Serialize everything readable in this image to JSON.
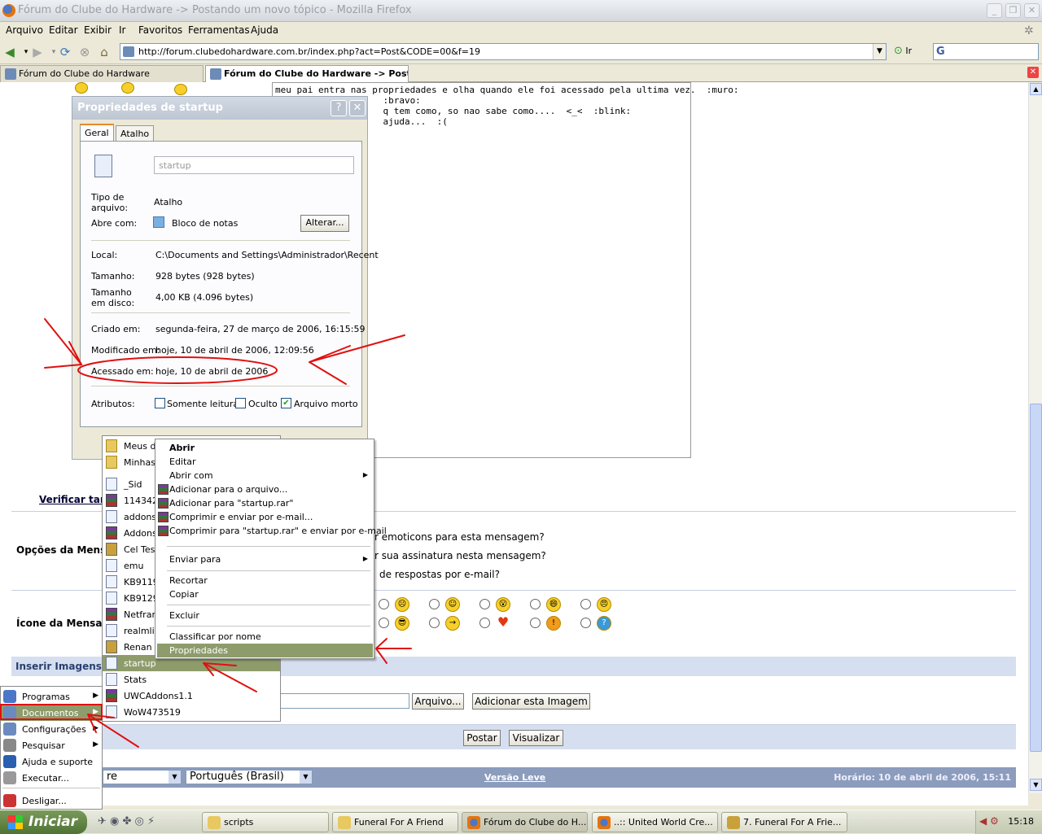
{
  "window": {
    "title": "Fórum do Clube do Hardware -> Postando um novo tópico - Mozilla Firefox"
  },
  "menubar": [
    "Arquivo",
    "Editar",
    "Exibir",
    "Ir",
    "Favoritos",
    "Ferramentas",
    "Ajuda"
  ],
  "navbar": {
    "url": "http://forum.clubedohardware.com.br/index.php?act=Post&CODE=00&f=19",
    "go_label": "Ir"
  },
  "tabs": [
    {
      "label": "Fórum do Clube do Hardware",
      "active": false
    },
    {
      "label": "Fórum do Clube do Hardware -> Post...",
      "active": true
    }
  ],
  "post": {
    "lines": [
      "meu pai entra nas propriedades e olha quando ele foi acessado pela ultima vez.  :muro:",
      "                    :bravo:",
      "                    q tem como, so nao sabe como....  <_<  :blink:",
      "                    ajuda...  :("
    ]
  },
  "form": {
    "verificar": "Verificar tar",
    "opcoes_label": "Opções da Mens",
    "opt1": "r emoticons para esta mensagem?",
    "opt2": "r sua assinatura nesta mensagem?",
    "opt3": "de respostas por e-mail?",
    "icone_label": "Ícone da Mensa",
    "inserir_label": "Inserir Imagens",
    "arquivo_button": "Arquivo...",
    "adicionar_button": "Adicionar esta Imagem",
    "postar_button": "Postar",
    "visualizar_button": "Visualizar"
  },
  "footer": {
    "skin_select": "re",
    "language_select": "Português (Brasil)",
    "versao_leve": "Versão Leve",
    "horario": "Horário: 10 de abril de 2006, 15:11"
  },
  "dialog": {
    "title": "Propriedades de startup",
    "tab_geral": "Geral",
    "tab_atalho": "Atalho",
    "name_value": "startup",
    "tipo_label": "Tipo de arquivo:",
    "tipo_value": "Atalho",
    "abre_label": "Abre com:",
    "abre_value": "Bloco de notas",
    "alterar_button": "Alterar...",
    "local_label": "Local:",
    "local_value": "C:\\Documents and Settings\\Administrador\\Recent",
    "tamanho_label": "Tamanho:",
    "tamanho_value": "928 bytes (928 bytes)",
    "tamanho_disco_label": "Tamanho em disco:",
    "tamanho_disco_value": "4,00 KB (4.096 bytes)",
    "criado_label": "Criado em:",
    "criado_value": "segunda-feira, 27 de março de 2006, 16:15:59",
    "modificado_label": "Modificado em:",
    "modificado_value": "hoje, 10 de abril de 2006, 12:09:56",
    "acessado_label": "Acessado em:",
    "acessado_value": "hoje, 10 de abril de 2006",
    "atributos_label": "Atributos:",
    "somente_leitura": "Somente leitura",
    "oculto": "Oculto",
    "arquivo_morto": "Arquivo morto"
  },
  "documents_menu": [
    {
      "label": "Meus do",
      "icon": "folder-icon"
    },
    {
      "label": "Minhas",
      "icon": "folder-icon"
    },
    {
      "label": "_Sid",
      "icon": "text-file-icon"
    },
    {
      "label": "114342",
      "icon": "rar-icon"
    },
    {
      "label": "addons",
      "icon": "text-file-icon"
    },
    {
      "label": "Addons",
      "icon": "rar-icon"
    },
    {
      "label": "Cel Tes",
      "icon": "image-icon"
    },
    {
      "label": "emu",
      "icon": "text-file-icon"
    },
    {
      "label": "KB9119",
      "icon": "text-file-icon"
    },
    {
      "label": "KB9129",
      "icon": "text-file-icon"
    },
    {
      "label": "Netfram",
      "icon": "rar-icon"
    },
    {
      "label": "realmlis",
      "icon": "text-file-icon"
    },
    {
      "label": "Renan r",
      "icon": "image-icon"
    },
    {
      "label": "startup",
      "icon": "text-file-icon"
    },
    {
      "label": "Stats",
      "icon": "text-file-icon"
    },
    {
      "label": "UWCAddons1.1",
      "icon": "rar-icon"
    },
    {
      "label": "WoW473519",
      "icon": "text-file-icon"
    }
  ],
  "start_menu": [
    {
      "label": "Programas",
      "submenu": true
    },
    {
      "label": "Documentos",
      "submenu": true
    },
    {
      "label": "Configurações",
      "submenu": true
    },
    {
      "label": "Pesquisar",
      "submenu": true
    },
    {
      "label": "Ajuda e suporte",
      "submenu": false
    },
    {
      "label": "Executar...",
      "submenu": false
    },
    {
      "label": "Desligar...",
      "submenu": false
    }
  ],
  "context_menu": {
    "abrir": "Abrir",
    "editar": "Editar",
    "abrir_com": "Abrir com",
    "add_arquivo": "Adicionar para o arquivo...",
    "add_rar": "Adicionar para \"startup.rar\"",
    "comprimir_email": "Comprimir e enviar por e-mail...",
    "comprimir_rar_email": "Comprimir para \"startup.rar\" e enviar por e-mail",
    "enviar_para": "Enviar para",
    "recortar": "Recortar",
    "copiar": "Copiar",
    "excluir": "Excluir",
    "classificar": "Classificar por nome",
    "propriedades": "Propriedades"
  },
  "taskbar": {
    "start_label": "Iniciar",
    "buttons": [
      "scripts",
      "Funeral For A Friend",
      "Fórum do Clube do H...",
      "..:: United World Cre...",
      "7. Funeral For A Frie..."
    ],
    "clock": "15:18"
  },
  "colors": {
    "highlight": "#8e9c6c",
    "annotation_red": "#e01010"
  }
}
